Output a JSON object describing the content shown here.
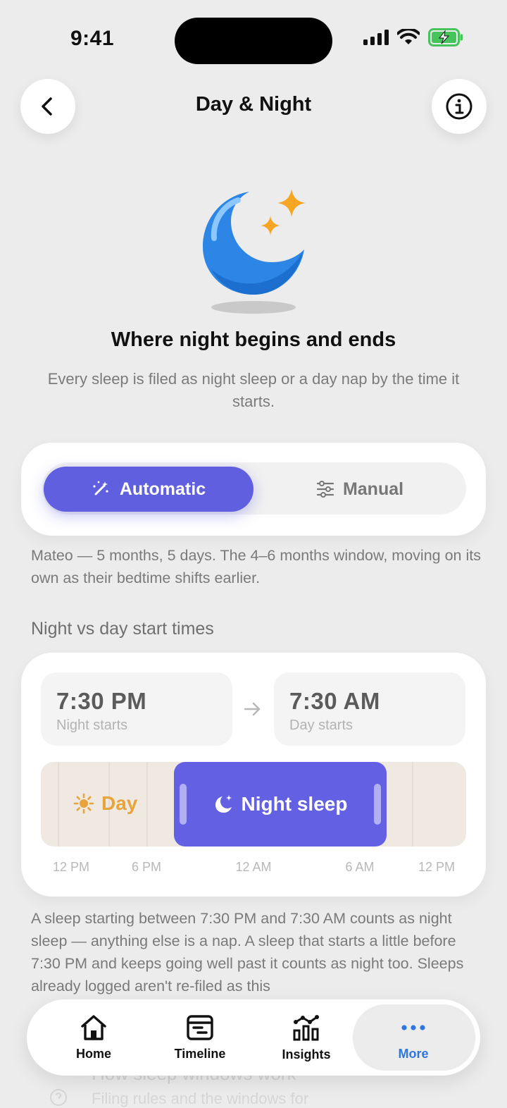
{
  "status": {
    "time": "9:41"
  },
  "header": {
    "title": "Day & Night"
  },
  "hero": {
    "title": "Where night begins and ends",
    "subtitle": "Every sleep is filed as night sleep or a day nap by the time it starts."
  },
  "mode": {
    "options": [
      "Automatic",
      "Manual"
    ],
    "selected": "Automatic"
  },
  "mode_note": "Mateo — 5 months, 5 days. The 4–6 months window, moving on its own as their bedtime shifts earlier.",
  "section": {
    "label": "Night vs day start times"
  },
  "times": {
    "night_start": {
      "value": "7:30 PM",
      "label": "Night starts"
    },
    "day_start": {
      "value": "7:30 AM",
      "label": "Day starts"
    }
  },
  "timeline": {
    "day_label": "Day",
    "night_label": "Night sleep",
    "ticks": [
      "12 PM",
      "6 PM",
      "12 AM",
      "6 AM",
      "12 PM"
    ]
  },
  "explanation": "A sleep starting between 7:30 PM and 7:30 AM counts as night sleep — anything else is a nap. A sleep that starts a little before 7:30 PM and keeps going well past it counts as night too. Sleeps already logged aren't re-filed as this",
  "behind_text": {
    "line1": "How sleep windows work",
    "line2": "Filing rules and the windows for"
  },
  "tabbar": {
    "items": [
      {
        "label": "Home",
        "icon": "home-icon"
      },
      {
        "label": "Timeline",
        "icon": "timeline-icon"
      },
      {
        "label": "Insights",
        "icon": "insights-icon"
      },
      {
        "label": "More",
        "icon": "more-icon"
      }
    ],
    "active": "More"
  },
  "colors": {
    "accent": "#5f5fe0",
    "day": "#e7a43a",
    "active_tab": "#2f76e0"
  }
}
